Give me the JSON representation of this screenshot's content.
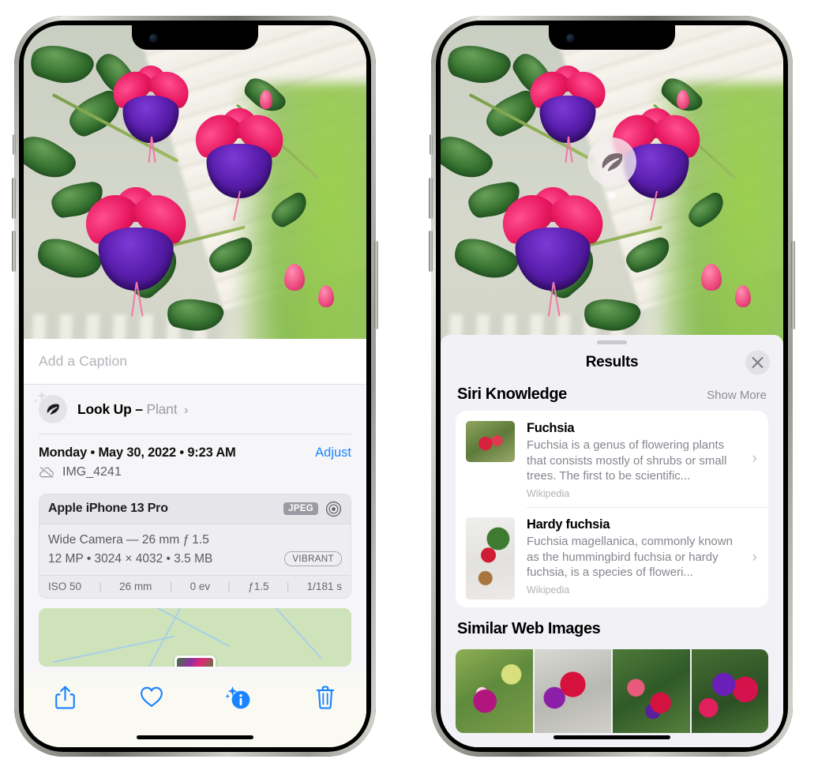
{
  "left_phone": {
    "name": "iphone-photos-info",
    "photo_alt": "Fuchsia flowers hanging basket",
    "caption_field": {
      "placeholder": "Add a Caption",
      "value": ""
    },
    "lookup": {
      "label": "Look Up –",
      "subject": "Plant",
      "chevron": "›",
      "icon": "leaf-icon",
      "sparkle": "sparkle-icon"
    },
    "meta": {
      "date": "Monday • May 30, 2022 • 9:23 AM",
      "adjust_label": "Adjust",
      "filename": "IMG_4241",
      "cloud_icon": "icloud-slash-icon"
    },
    "exif": {
      "device": "Apple iPhone 13 Pro",
      "format_chip": "JPEG",
      "aperture_icon": "aperture-icon",
      "lens_line": "Wide Camera — 26 mm ƒ 1.5",
      "size_line": "12 MP • 3024 × 4032 • 3.5 MB",
      "vibrant_chip": "VIBRANT",
      "stats": [
        "ISO 50",
        "26 mm",
        "0 ev",
        "ƒ1.5",
        "1/181 s"
      ],
      "separator": "|"
    },
    "map": {
      "label": "photo-location-map"
    },
    "toolbar": [
      {
        "name": "share-button",
        "icon": "share-icon"
      },
      {
        "name": "favorite-button",
        "icon": "heart-icon"
      },
      {
        "name": "info-button",
        "icon": "info-sparkle-icon"
      },
      {
        "name": "delete-button",
        "icon": "trash-icon"
      }
    ],
    "accent_color": "#1a84ff"
  },
  "right_phone": {
    "name": "iphone-visual-lookup-results",
    "leaf_badge": {
      "icon": "leaf-icon",
      "label": "visual-lookup-badge"
    },
    "sheet": {
      "title": "Results",
      "close_icon": "close-icon",
      "grabber": "sheet-grabber"
    },
    "siri_knowledge": {
      "section_title": "Siri Knowledge",
      "show_more": "Show More",
      "items": [
        {
          "title": "Fuchsia",
          "description": "Fuchsia is a genus of flowering plants that consists mostly of shrubs or small trees. The first to be scientific...",
          "source": "Wikipedia",
          "chevron": "›",
          "thumb": "fuchsia-red-flowers-thumb"
        },
        {
          "title": "Hardy fuchsia",
          "description": "Fuchsia magellanica, commonly known as the hummingbird fuchsia or hardy fuchsia, is a species of floweri...",
          "source": "Wikipedia",
          "chevron": "›",
          "thumb": "hardy-fuchsia-branch-thumb"
        }
      ]
    },
    "similar_web_images": {
      "section_title": "Similar Web Images",
      "items": [
        "fuchsia-pink-purple-thumb",
        "fuchsia-red-closeup-thumb",
        "fuchsia-bush-thumb",
        "fuchsia-purple-red-thumb"
      ]
    }
  }
}
